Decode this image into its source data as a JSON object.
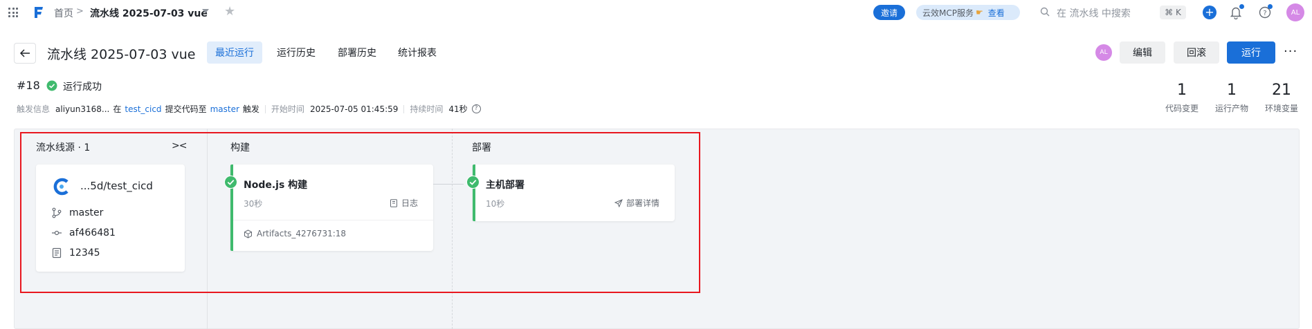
{
  "topbar": {
    "breadcrumb_home": "首页",
    "breadcrumb_sep": ">",
    "breadcrumb_current": "流水线 2025-07-03 vue",
    "invite_label": "邀请",
    "mcp_label": "云效MCP服务",
    "mcp_view": "查看",
    "search_placeholder": "在 流水线 中搜索",
    "shortcut": "⌘ K",
    "avatar": "AL"
  },
  "header": {
    "title": "流水线 2025-07-03 vue",
    "tabs": [
      {
        "label": "最近运行",
        "active": true
      },
      {
        "label": "运行历史",
        "active": false
      },
      {
        "label": "部署历史",
        "active": false
      },
      {
        "label": "统计报表",
        "active": false
      }
    ],
    "avatar": "AL",
    "edit_label": "编辑",
    "rollback_label": "回滚",
    "run_label": "运行",
    "more": "···"
  },
  "run": {
    "number": "#18",
    "status": "运行成功",
    "trigger_label": "触发信息",
    "trigger_user": "aliyun3168...",
    "trigger_in": "在",
    "trigger_repo": "test_cicd",
    "trigger_action": "提交代码至",
    "trigger_branch": "master",
    "trigger_suffix": "触发",
    "start_label": "开始时间",
    "start_time": "2025-07-05 01:45:59",
    "duration_label": "持续时间",
    "duration": "41秒",
    "help": "?"
  },
  "stats": [
    {
      "value": "1",
      "caption": "代码变更"
    },
    {
      "value": "1",
      "caption": "运行产物"
    },
    {
      "value": "21",
      "caption": "环境变量"
    }
  ],
  "stages": {
    "source_title": "流水线源 · 1",
    "collapse": "><",
    "build_title": "构建",
    "deploy_title": "部署"
  },
  "source": {
    "name": "...5d/test_cicd",
    "branch": "master",
    "commit": "af466481",
    "message": "12345"
  },
  "build_job": {
    "name": "Node.js 构建",
    "duration": "30秒",
    "action": "日志",
    "artifact": "Artifacts_4276731:18"
  },
  "deploy_job": {
    "name": "主机部署",
    "duration": "10秒",
    "action": "部署详情"
  },
  "colors": {
    "primary": "#1a6fd8",
    "success": "#3fba6d",
    "highlight": "#e8171f",
    "avatar": "#d589e6"
  }
}
